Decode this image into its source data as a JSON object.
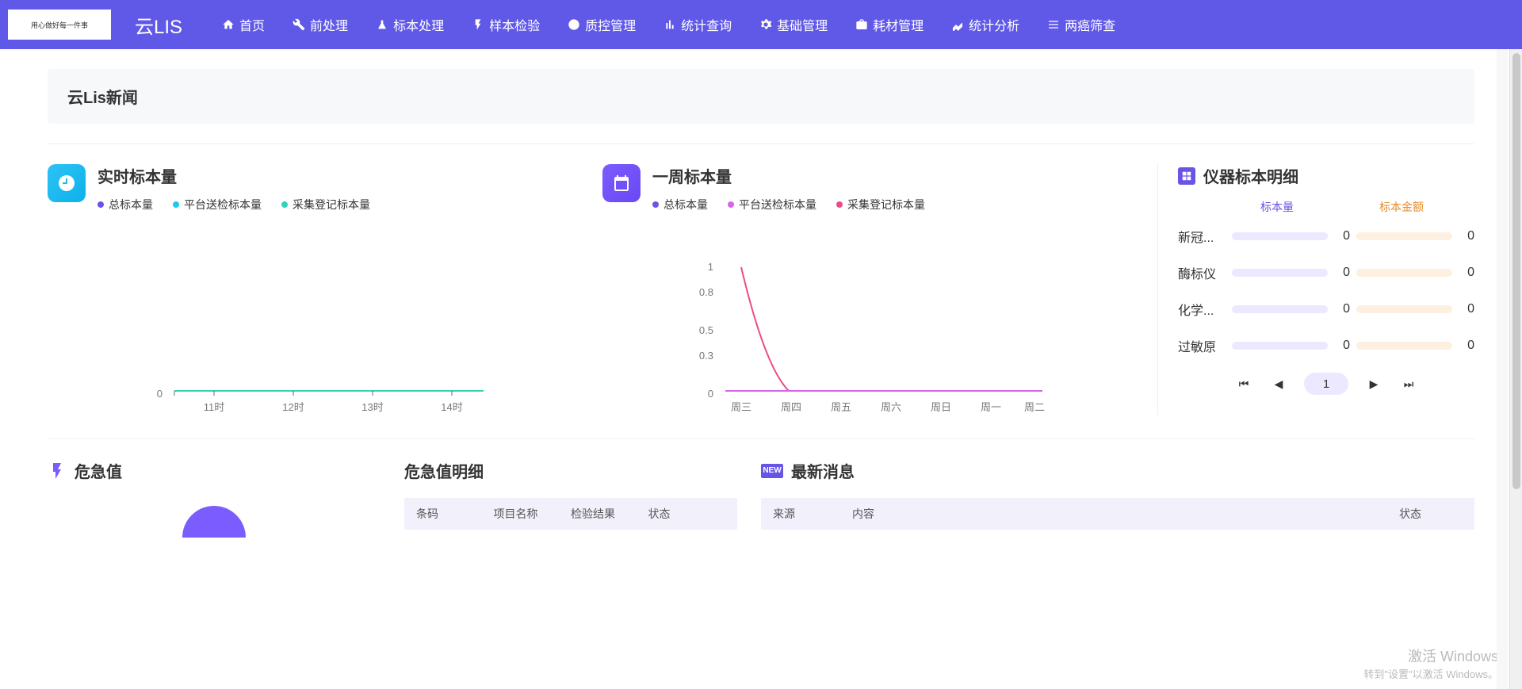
{
  "brand": "云LIS",
  "logo_tagline": "用心做好每一件事",
  "nav": [
    {
      "label": "首页",
      "icon": "home"
    },
    {
      "label": "前处理",
      "icon": "wrench"
    },
    {
      "label": "标本处理",
      "icon": "flask"
    },
    {
      "label": "样本检验",
      "icon": "vial"
    },
    {
      "label": "质控管理",
      "icon": "pie"
    },
    {
      "label": "统计查询",
      "icon": "bars"
    },
    {
      "label": "基础管理",
      "icon": "gear"
    },
    {
      "label": "耗材管理",
      "icon": "briefcase"
    },
    {
      "label": "统计分析",
      "icon": "chart"
    },
    {
      "label": "两癌筛查",
      "icon": "list"
    }
  ],
  "news_panel_title": "云Lis新闻",
  "realtime": {
    "title": "实时标本量",
    "legend": [
      {
        "label": "总标本量",
        "color": "#6855e8"
      },
      {
        "label": "平台送检标本量",
        "color": "#1ec9e8"
      },
      {
        "label": "采集登记标本量",
        "color": "#37d1b5"
      }
    ],
    "xaxis": [
      "11时",
      "12时",
      "13时",
      "14时"
    ],
    "yaxis": [
      "0"
    ]
  },
  "weekly": {
    "title": "一周标本量",
    "legend": [
      {
        "label": "总标本量",
        "color": "#6855e8"
      },
      {
        "label": "平台送检标本量",
        "color": "#d665e8"
      },
      {
        "label": "采集登记标本量",
        "color": "#ea4c89"
      }
    ],
    "xaxis": [
      "周三",
      "周四",
      "周五",
      "周六",
      "周日",
      "周一",
      "周二"
    ],
    "yaxis": [
      "1",
      "0.8",
      "0.5",
      "0.3",
      "0"
    ]
  },
  "instruments": {
    "title": "仪器标本明细",
    "headers": {
      "qty": "标本量",
      "amount": "标本金额"
    },
    "rows": [
      {
        "name": "新冠...",
        "qty": "0",
        "amount": "0"
      },
      {
        "name": "酶标仪",
        "qty": "0",
        "amount": "0"
      },
      {
        "name": "化学...",
        "qty": "0",
        "amount": "0"
      },
      {
        "name": "过敏原",
        "qty": "0",
        "amount": "0"
      }
    ],
    "page": "1"
  },
  "critical": {
    "title": "危急值"
  },
  "critical_detail": {
    "title": "危急值明细",
    "cols": [
      "条码",
      "项目名称",
      "检验结果",
      "状态"
    ]
  },
  "latest_news": {
    "title": "最新消息",
    "badge": "NEW",
    "cols": [
      "来源",
      "内容",
      "状态"
    ]
  },
  "watermark": {
    "line1": "激活 Windows",
    "line2": "转到\"设置\"以激活 Windows。"
  },
  "chart_data": [
    {
      "type": "line",
      "title": "实时标本量",
      "categories": [
        "11时",
        "12时",
        "13时",
        "14时"
      ],
      "series": [
        {
          "name": "总标本量",
          "values": [
            0,
            0,
            0,
            0
          ]
        },
        {
          "name": "平台送检标本量",
          "values": [
            0,
            0,
            0,
            0
          ]
        },
        {
          "name": "采集登记标本量",
          "values": [
            0,
            0,
            0,
            0
          ]
        }
      ],
      "ylim": [
        0,
        1
      ]
    },
    {
      "type": "line",
      "title": "一周标本量",
      "categories": [
        "周三",
        "周四",
        "周五",
        "周六",
        "周日",
        "周一",
        "周二"
      ],
      "series": [
        {
          "name": "总标本量",
          "values": [
            1,
            0,
            0,
            0,
            0,
            0,
            0
          ]
        },
        {
          "name": "平台送检标本量",
          "values": [
            0,
            0,
            0,
            0,
            0,
            0,
            0
          ]
        },
        {
          "name": "采集登记标本量",
          "values": [
            1,
            0,
            0,
            0,
            0,
            0,
            0
          ]
        }
      ],
      "ylim": [
        0,
        1
      ]
    }
  ]
}
